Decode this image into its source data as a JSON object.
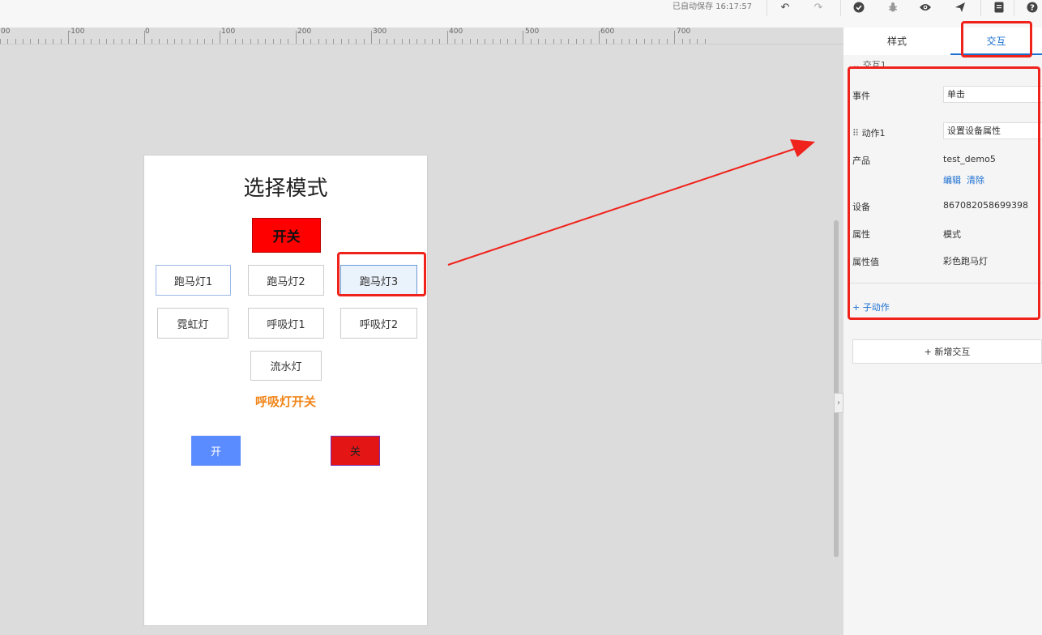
{
  "toolbar": {
    "saved_text": "已自动保存 16:17:57",
    "icons": [
      "undo-icon",
      "redo-icon",
      "check-circle-icon",
      "bug-icon",
      "eye-icon",
      "send-icon",
      "document-icon",
      "help-icon"
    ]
  },
  "ruler": {
    "labels": [
      "00",
      "-100",
      "0",
      "100",
      "200",
      "300",
      "400",
      "500",
      "600",
      "700"
    ]
  },
  "canvas": {
    "page_title": "选择模式",
    "switch_label": "开关",
    "buttons": [
      "跑马灯1",
      "跑马灯2",
      "跑马灯3",
      "霓虹灯",
      "呼吸灯1",
      "呼吸灯2",
      "流水灯"
    ],
    "breath_title": "呼吸灯开关",
    "on_label": "开",
    "off_label": "关"
  },
  "panel": {
    "tab_style": "样式",
    "tab_interaction": "交互",
    "section_header": "交互1",
    "event_label": "事件",
    "event_value": "单击",
    "action_label": "动作1",
    "action_value": "设置设备属性",
    "product_label": "产品",
    "product_value": "test_demo5",
    "edit_link": "编辑",
    "clear_link": "清除",
    "device_label": "设备",
    "device_value": "867082058699398",
    "property_label": "属性",
    "property_value": "模式",
    "property_value_label": "属性值",
    "property_value_value": "彩色跑马灯",
    "sub_action": "+ 子动作",
    "add_interaction": "+ 新增交互"
  },
  "colors": {
    "annotation_red": "#f0221c",
    "link_blue": "#1a6fd1",
    "orange": "#f08519",
    "switch_red": "#ff0000",
    "on_blue": "#5b8cff",
    "off_red": "#e31515"
  }
}
